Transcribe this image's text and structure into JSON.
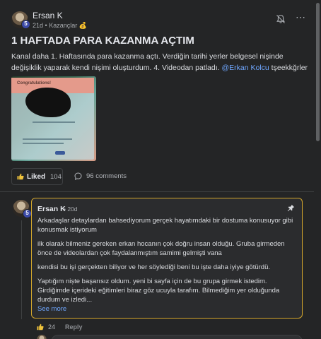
{
  "post": {
    "author": "Ersan K",
    "badge": "5",
    "time": "21d",
    "category": "Kazançlar",
    "category_emoji": "💰",
    "title": "1 HAFTADA PARA KAZANMA AÇTIM",
    "body": "Kanal daha 1. Haftasında para kazanma açtı. Verdiğin tarihi yerler belgesel nişinde değişiklik yaparak kendi nişimi oluşturdum. 4. Videodan patladı. ",
    "mention": "@Erkan Kolcu",
    "body_tail": " tşeekkğrler",
    "media_caption": "Congratulations!",
    "like_label": "Liked",
    "like_count": "104",
    "comments_label": "96 comments"
  },
  "comment": {
    "author": "Ersan K",
    "badge": "5",
    "time": "20d",
    "paragraphs": [
      "Arkadaşlar detaylardan bahsediyorum gerçek hayatımdaki bir dostuma konusuyor gibi konusmak istiyorum",
      "ilk olarak bilmeniz gereken erkan hocanın çok doğru insan olduğu. Gruba girmeden önce de videolardan çok faydalanmıştım samimi gelmişti vana",
      "kendisi bu işi gerçekten biliyor ve her söylediği beni bu işte daha iyiye götürdü.",
      "Yaptığım niște başarısız oldum. yeni bi sayfa için de bu grupa girmek istedim. Girdiğimde içerideki eğitimleri biraz göz ucuyla tarafım. Bilmediğim yer olduğunda durdum ve izledi..."
    ],
    "see_more": "See more",
    "upvotes": "24",
    "reply_label": "Reply"
  },
  "icons": {
    "bell": "bell-icon",
    "more": "more-dots-icon",
    "like": "thumbs-up-icon",
    "comment": "comment-bubble-icon",
    "pin": "pin-icon"
  },
  "colors": {
    "background": "#242526",
    "link": "#6fa7ff",
    "highlight_border": "#d4a72c",
    "like_icon": "#f0c43c"
  }
}
